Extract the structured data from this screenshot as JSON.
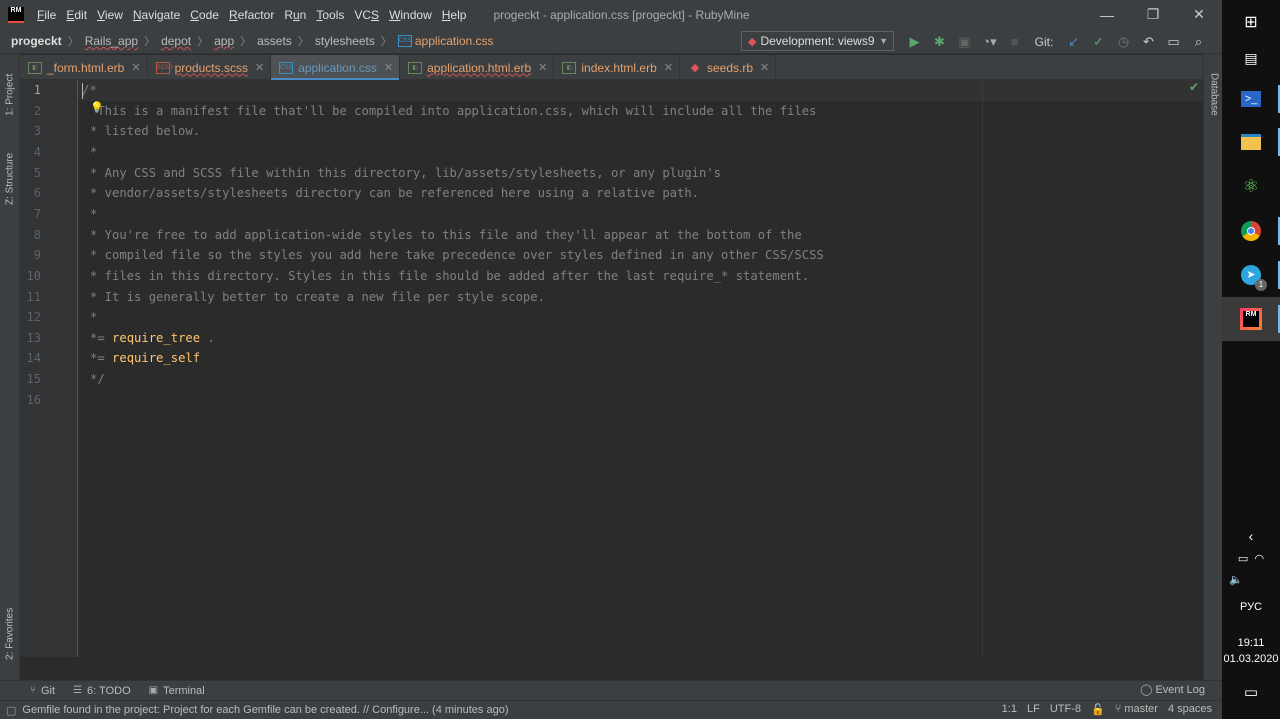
{
  "titlebar": {
    "logo": "RM",
    "menu": [
      {
        "pre": "",
        "u": "F",
        "post": "ile"
      },
      {
        "pre": "",
        "u": "E",
        "post": "dit"
      },
      {
        "pre": "",
        "u": "V",
        "post": "iew"
      },
      {
        "pre": "",
        "u": "N",
        "post": "avigate"
      },
      {
        "pre": "",
        "u": "C",
        "post": "ode"
      },
      {
        "pre": "",
        "u": "R",
        "post": "efactor"
      },
      {
        "pre": "R",
        "u": "u",
        "post": "n"
      },
      {
        "pre": "",
        "u": "T",
        "post": "ools"
      },
      {
        "pre": "VC",
        "u": "S",
        "post": ""
      },
      {
        "pre": "",
        "u": "W",
        "post": "indow"
      },
      {
        "pre": "",
        "u": "H",
        "post": "elp"
      }
    ],
    "window_title": "progeckt - application.css [progeckt] - RubyMine",
    "minimize": "—",
    "restore": "❐",
    "close": "✕"
  },
  "navbar": {
    "crumbs": [
      "progeckt",
      "Rails_app",
      "depot",
      "app",
      "assets",
      "stylesheets",
      "application.css"
    ],
    "run_config": "Development: views9",
    "git_label": "Git:"
  },
  "tabs": [
    {
      "name": "_form.html.erb",
      "icon": "erb",
      "close": "✕"
    },
    {
      "name": "products.scss",
      "icon": "scss",
      "close": "✕"
    },
    {
      "name": "application.css",
      "icon": "css",
      "close": "✕"
    },
    {
      "name": "application.html.erb",
      "icon": "erb",
      "close": "✕"
    },
    {
      "name": "index.html.erb",
      "icon": "erb",
      "close": "✕"
    },
    {
      "name": "seeds.rb",
      "icon": "ruby",
      "close": "✕"
    }
  ],
  "left_stripe": {
    "project": "1: Project",
    "structure": "Z: Structure",
    "favorites": "2: Favorites"
  },
  "right_stripe": {
    "database": "Database"
  },
  "editor": {
    "line_numbers": [
      "1",
      "2",
      "3",
      "4",
      "5",
      "6",
      "7",
      "8",
      "9",
      "10",
      "11",
      "12",
      "13",
      "14",
      "15",
      "16"
    ],
    "lines": [
      "/*",
      " This is a manifest file that'll be compiled into application.css, which will include all the files",
      "* listed below.",
      "*",
      "* Any CSS and SCSS file within this directory, lib/assets/stylesheets, or any plugin's",
      "* vendor/assets/stylesheets directory can be referenced here using a relative path.",
      "*",
      "* You're free to add application-wide styles to this file and they'll appear at the bottom of the",
      "* compiled file so the styles you add here take precedence over styles defined in any other CSS/SCSS",
      "* files in this directory. Styles in this file should be added after the last require_* statement.",
      "* It is generally better to create a new file per style scope.",
      "*",
      "",
      "",
      "*/",
      ""
    ],
    "directive_prefix": "*=",
    "require_tree": "require_tree",
    "require_tree_arg": ".",
    "require_self": "require_self"
  },
  "bottom_tools": {
    "git": "Git",
    "todo": "6: TODO",
    "terminal": "Terminal",
    "event_log": "Event Log"
  },
  "statusbar": {
    "message": "Gemfile found in the project: Project for each Gemfile can be created. // Configure... (4 minutes ago)",
    "position": "1:1",
    "line_sep": "LF",
    "encoding": "UTF-8",
    "branch": "master",
    "indent": "4 spaces"
  },
  "taskbar": {
    "lang": "РУС",
    "time": "19:11",
    "date": "01.03.2020",
    "badge": "1"
  },
  "colors": {
    "accent": "#4a88c7",
    "keyword": "#ffc66d",
    "comment": "#808080",
    "modified_file": "#e4a170"
  }
}
